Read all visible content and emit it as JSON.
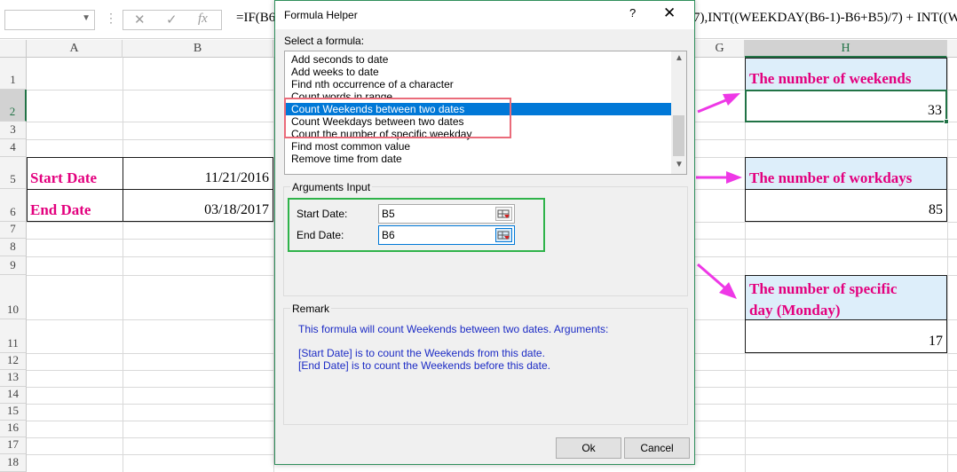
{
  "formula_bar": {
    "name_box": "",
    "cancel_icon": "✕",
    "enter_icon": "✓",
    "fx_label": "fx",
    "formula_left": "=IF(B6",
    "formula_right": "7),INT((WEEKDAY(B6-1)-B6+B5)/7) + INT((W"
  },
  "columns": [
    {
      "name": "A",
      "selected": false
    },
    {
      "name": "B",
      "selected": false
    },
    {
      "name": "G",
      "selected": false
    },
    {
      "name": "H",
      "selected": true
    }
  ],
  "rows": [
    "1",
    "2",
    "3",
    "4",
    "5",
    "6",
    "7",
    "8",
    "9",
    "10",
    "11",
    "12",
    "13",
    "14",
    "15",
    "16",
    "17",
    "18"
  ],
  "selected_row": "2",
  "cells": {
    "start_date_label": "Start Date",
    "start_date_value": "11/21/2016",
    "end_date_label": "End Date",
    "end_date_value": "03/18/2017",
    "weekends_label": "The number of weekends",
    "weekends_value": "33",
    "workdays_label": "The number of workdays",
    "workdays_value": "85",
    "specific_label_line1": "The number of specific",
    "specific_label_line2": "day (Monday)",
    "specific_value": "17"
  },
  "colors": {
    "label_pink": "#e3007e",
    "header_fill": "#ddeefa",
    "arrow_magenta": "#ee38e6",
    "selection_blue": "#0078d7",
    "remark_blue": "#1c2bc5"
  },
  "dialog": {
    "title": "Formula Helper",
    "help": "?",
    "close": "✕",
    "select_label": "Select a formula:",
    "formulas": [
      "Add seconds to date",
      "Add weeks to date",
      "Find nth occurrence of a character",
      "Count words in range",
      "Count Weekends between two dates",
      "Count Weekdays between two dates",
      "Count the number of specific weekday",
      "Find most common value",
      "Remove time from date"
    ],
    "selected_formula_index": 4,
    "arguments_title": "Arguments Input",
    "start_date_label": "Start Date:",
    "start_date_value": "B5",
    "end_date_label": "End Date:",
    "end_date_value": "B6",
    "remark_title": "Remark",
    "remark_line1": "This formula will count Weekends between two dates. Arguments:",
    "remark_line2": "[Start Date] is to count the Weekends from this date.",
    "remark_line3": "[End Date] is to count the Weekends before this date.",
    "ok_label": "Ok",
    "cancel_label": "Cancel"
  }
}
